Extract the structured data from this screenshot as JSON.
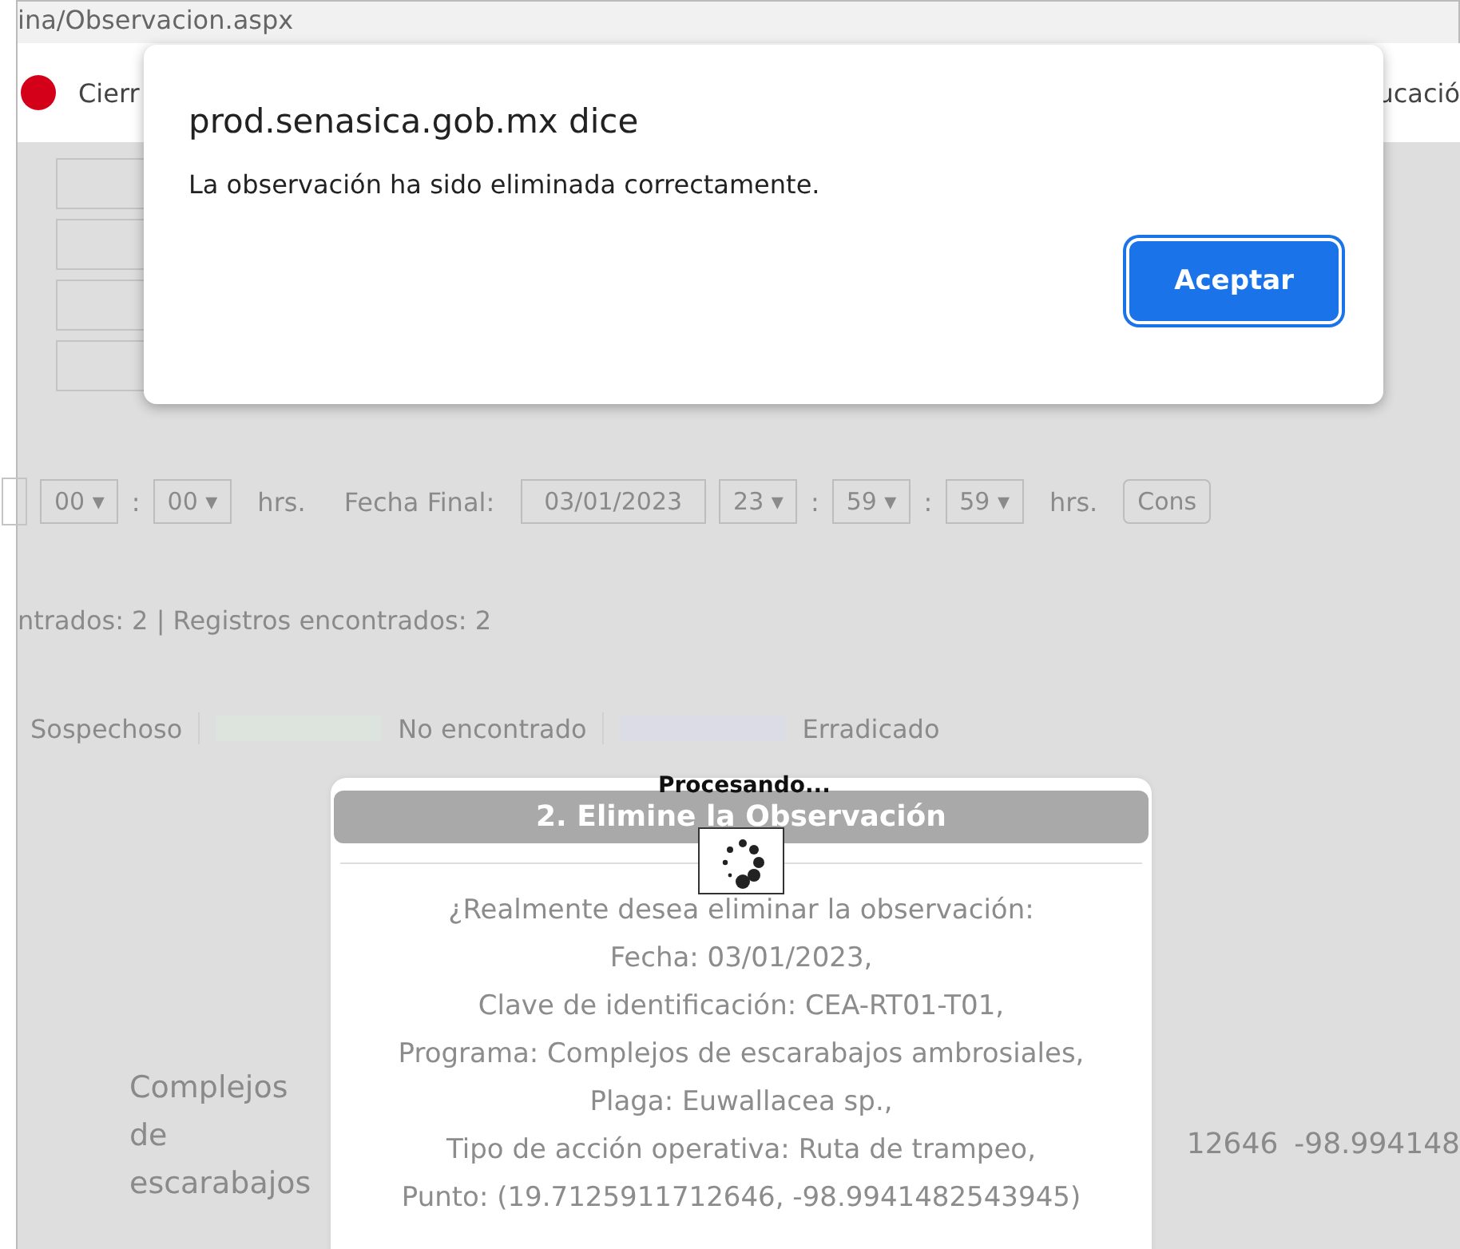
{
  "address_bar": {
    "url": "ina/Observacion.aspx"
  },
  "browser_tabs": [
    {
      "label": "Cierr"
    },
    {
      "label": "ucació"
    }
  ],
  "filters": [
    {
      "kind": "select",
      "text": "00 ▾"
    },
    {
      "kind": "sep",
      "text": ":"
    },
    {
      "kind": "select",
      "text": "00 ▾"
    },
    {
      "kind": "label",
      "text": "hrs."
    },
    {
      "kind": "label",
      "text": "Fecha Final:"
    },
    {
      "kind": "date",
      "text": "03/01/2023"
    },
    {
      "kind": "select",
      "text": "23 ▾"
    },
    {
      "kind": "sep",
      "text": ":"
    },
    {
      "kind": "select",
      "text": "59 ▾"
    },
    {
      "kind": "sep",
      "text": ":"
    },
    {
      "kind": "select",
      "text": "59 ▾"
    },
    {
      "kind": "label",
      "text": "hrs."
    },
    {
      "kind": "button",
      "text": "Cons"
    }
  ],
  "counts": "ntrados: 2 | Registros encontrados: 2",
  "legend": [
    {
      "label": "Sospechoso"
    },
    {
      "label": "No encontrado",
      "color": "#dde3dd"
    },
    {
      "label": "Erradicado",
      "color": "#dcdce6"
    }
  ],
  "table_row": {
    "cells": [
      "Complejos de escarabajos",
      "12646",
      "-98.994148"
    ]
  },
  "modal": {
    "title": "2. Elimine la Observación",
    "lines": [
      "¿Realmente desea eliminar la observación:",
      "Fecha: 03/01/2023,",
      "Clave de identificación: CEA-RT01-T01,",
      "Programa: Complejos de escarabajos ambrosiales,",
      "Plaga: Euwallacea sp.,",
      "Tipo de acción operativa: Ruta de trampeo,",
      "Punto: (19.7125911712646, -98.9941482543945)"
    ],
    "loading": "Procesando..."
  },
  "alert": {
    "title": "prod.senasica.gob.mx dice",
    "message": "La observación ha sido eliminada correctamente.",
    "button": "Aceptar"
  }
}
